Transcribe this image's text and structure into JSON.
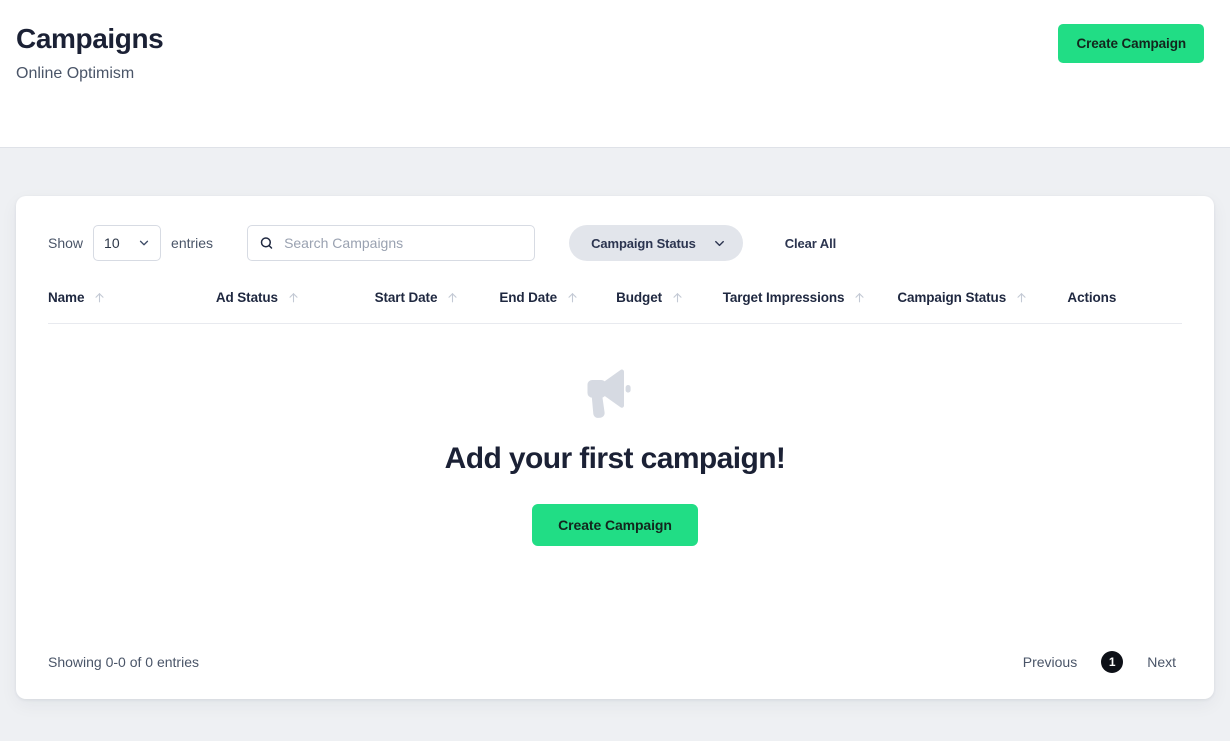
{
  "header": {
    "title": "Campaigns",
    "subtitle": "Online Optimism",
    "create_button": "Create Campaign"
  },
  "toolbar": {
    "show_label": "Show",
    "entries_value": "10",
    "entries_label": "entries",
    "search_placeholder": "Search Campaigns",
    "search_value": "",
    "status_filter_label": "Campaign Status",
    "clear_all_label": "Clear All"
  },
  "table": {
    "columns": [
      {
        "label": "Name",
        "sortable": true
      },
      {
        "label": "Ad Status",
        "sortable": true
      },
      {
        "label": "Start Date",
        "sortable": true
      },
      {
        "label": "End Date",
        "sortable": true
      },
      {
        "label": "Budget",
        "sortable": true
      },
      {
        "label": "Target Impressions",
        "sortable": true
      },
      {
        "label": "Campaign Status",
        "sortable": true
      },
      {
        "label": "Actions",
        "sortable": false
      }
    ],
    "rows": []
  },
  "empty_state": {
    "icon": "megaphone-icon",
    "title": "Add your first campaign!",
    "button": "Create Campaign"
  },
  "footer": {
    "showing_text": "Showing 0-0 of 0 entries",
    "previous_label": "Previous",
    "current_page": "1",
    "next_label": "Next"
  },
  "colors": {
    "accent_green": "#21dd85",
    "page_background": "#eef0f3",
    "card_background": "#ffffff",
    "text_dark": "#1b2135",
    "pill_background": "#e2e5eb",
    "empty_icon_gray": "#d3d8e0"
  }
}
